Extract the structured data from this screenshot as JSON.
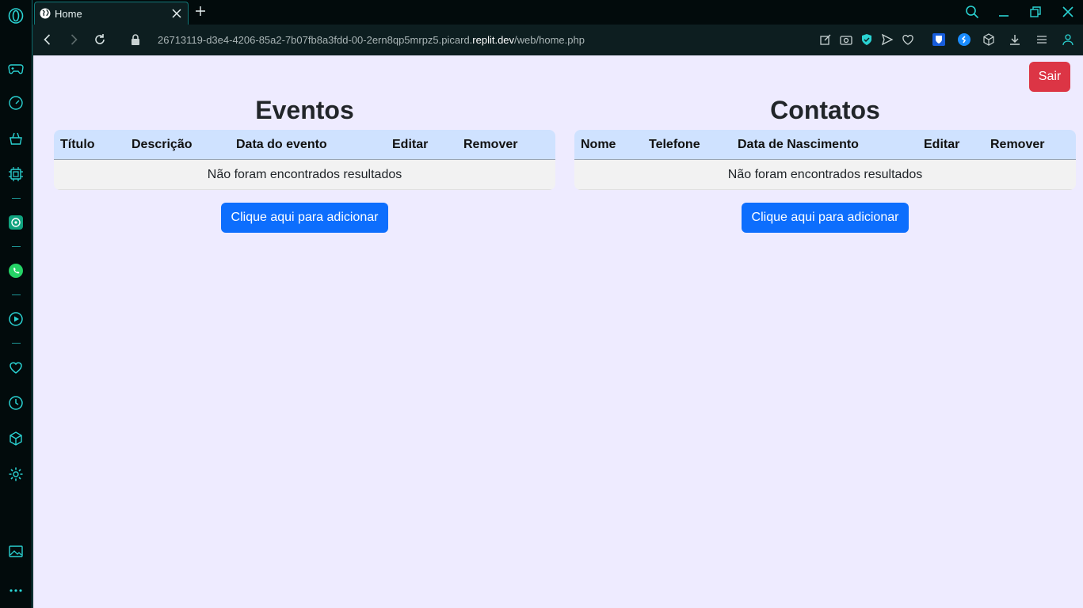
{
  "browser": {
    "tab_title": "Home",
    "url_prefix": "26713119-d3e4-4206-85a2-7b07fb8a3fdd-00-2ern8qp5mrpz5.picard.",
    "url_domain": "replit.dev",
    "url_path": "/web/home.php",
    "accent": "#2ad2d2"
  },
  "header": {
    "logout_label": "Sair"
  },
  "eventos": {
    "title": "Eventos",
    "columns": [
      "Título",
      "Descrição",
      "Data do evento",
      "Editar",
      "Remover"
    ],
    "empty_message": "Não foram encontrados resultados",
    "add_label": "Clique aqui para adicionar"
  },
  "contatos": {
    "title": "Contatos",
    "columns": [
      "Nome",
      "Telefone",
      "Data de Nascimento",
      "Editar",
      "Remover"
    ],
    "empty_message": "Não foram encontrados resultados",
    "add_label": "Clique aqui para adicionar"
  },
  "colors": {
    "page_bg": "#eeebff",
    "danger": "#dc3545",
    "primary": "#0d6efd",
    "table_header": "#cfe2ff"
  }
}
